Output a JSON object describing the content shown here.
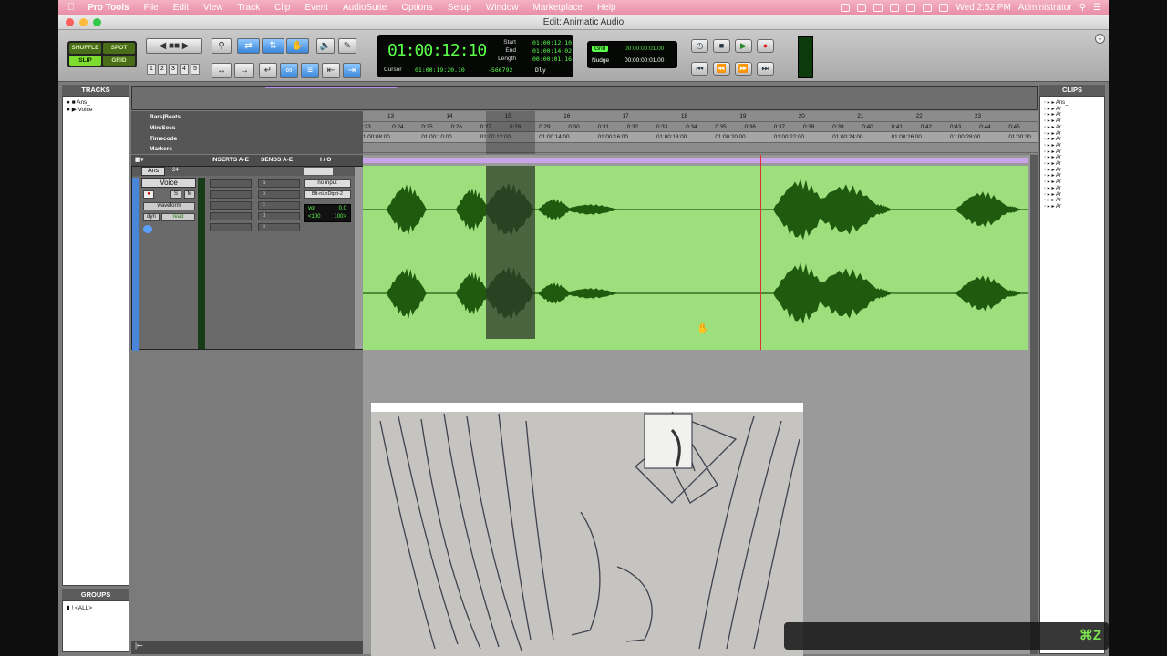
{
  "menubar": {
    "items": [
      "Pro Tools",
      "File",
      "Edit",
      "View",
      "Track",
      "Clip",
      "Event",
      "AudioSuite",
      "Options",
      "Setup",
      "Window",
      "Marketplace",
      "Help"
    ],
    "clock": "Wed 2:52 PM",
    "user": "Administrator"
  },
  "window": {
    "title": "Edit: Animatic Audio"
  },
  "toolbar": {
    "modes": [
      "SHUFFLE",
      "SPOT",
      "SLIP",
      "GRID"
    ],
    "zoom_presets": [
      "1",
      "2",
      "3",
      "4",
      "5"
    ],
    "counter": {
      "main": "01:00:12:10",
      "start_label": "Start",
      "start": "01:00:12:10",
      "end_label": "End",
      "end": "01:00:14:02",
      "length_label": "Length",
      "length": "00:00:01:16",
      "cursor_label": "Cursor",
      "cursor": "01:00:19:20.10",
      "sample": "-566792",
      "dly": "Dly"
    },
    "grid": {
      "grid_label": "Grid",
      "grid_value": "00:00:00:01.00",
      "nudge_label": "Nudge",
      "nudge_value": "00:00:00:01.00"
    }
  },
  "tracks_panel": {
    "header": "TRACKS",
    "items": [
      "Ans_",
      "Voice"
    ]
  },
  "groups_panel": {
    "header": "GROUPS",
    "items": [
      "<ALL>"
    ]
  },
  "clips_panel": {
    "header": "CLIPS",
    "items": [
      "Ans_",
      "Ar",
      "Ar",
      "Ar",
      "Ar",
      "Ar",
      "Ar",
      "Ar",
      "Ar",
      "Ar",
      "Ar",
      "Ar",
      "Ar",
      "Ar",
      "Ar",
      "Ar",
      "Ar",
      "Ar"
    ]
  },
  "rulers": {
    "labels": [
      "Bars|Beats",
      "Min:Secs",
      "Timecode",
      "Markers"
    ],
    "bars": [
      "13",
      "14",
      "15",
      "16",
      "17",
      "18",
      "19",
      "20",
      "21",
      "22",
      "23"
    ],
    "secs": [
      ":23",
      "0:24",
      "0:25",
      "0:26",
      "0:27",
      "0:28",
      "0:29",
      "0:30",
      "0:31",
      "0:32",
      "0:33",
      "0:34",
      "0:35",
      "0:36",
      "0:37",
      "0:38",
      "0:39",
      "0:40",
      "0:41",
      "0:42",
      "0:43",
      "0:44",
      "0:45"
    ],
    "timecode": [
      "1:00:08:00",
      "01:00:10:00",
      "01:00:12:00",
      "01:00:14:00",
      "01:00:16:00",
      "01:00:18:00",
      "01:00:20:00",
      "01:00:22:00",
      "01:00:24:00",
      "01:00:26:00",
      "01:00:28:00",
      "01:00:30"
    ]
  },
  "track_columns": {
    "inserts": "INSERTS A-E",
    "sends": "SENDS A-E",
    "io": "I / O"
  },
  "tracks": [
    {
      "name": "Ans",
      "num": "24"
    },
    {
      "name": "Voice",
      "rec": "●",
      "solo": "S",
      "mute": "M",
      "view": "waveform",
      "auto_label": "dyn",
      "auto_mode": "read",
      "insert_slots": [
        "",
        "",
        "",
        "",
        ""
      ],
      "send_slots": [
        "a",
        "b",
        "c",
        "d",
        "e"
      ],
      "input": "no input",
      "output": "Blt-nLnDtptt-2",
      "vol_label": "vol",
      "vol": "0.0",
      "pan_l": "<100",
      "pan_r": "100>"
    }
  ],
  "hud": {
    "shortcut": "⌘Z"
  },
  "colors": {
    "menubar": "#e98fa8",
    "clip": "#9ddf7c",
    "wave": "#1f5a0f",
    "selection": "#2e3b2a",
    "lcd_text": "#5cff4c"
  }
}
